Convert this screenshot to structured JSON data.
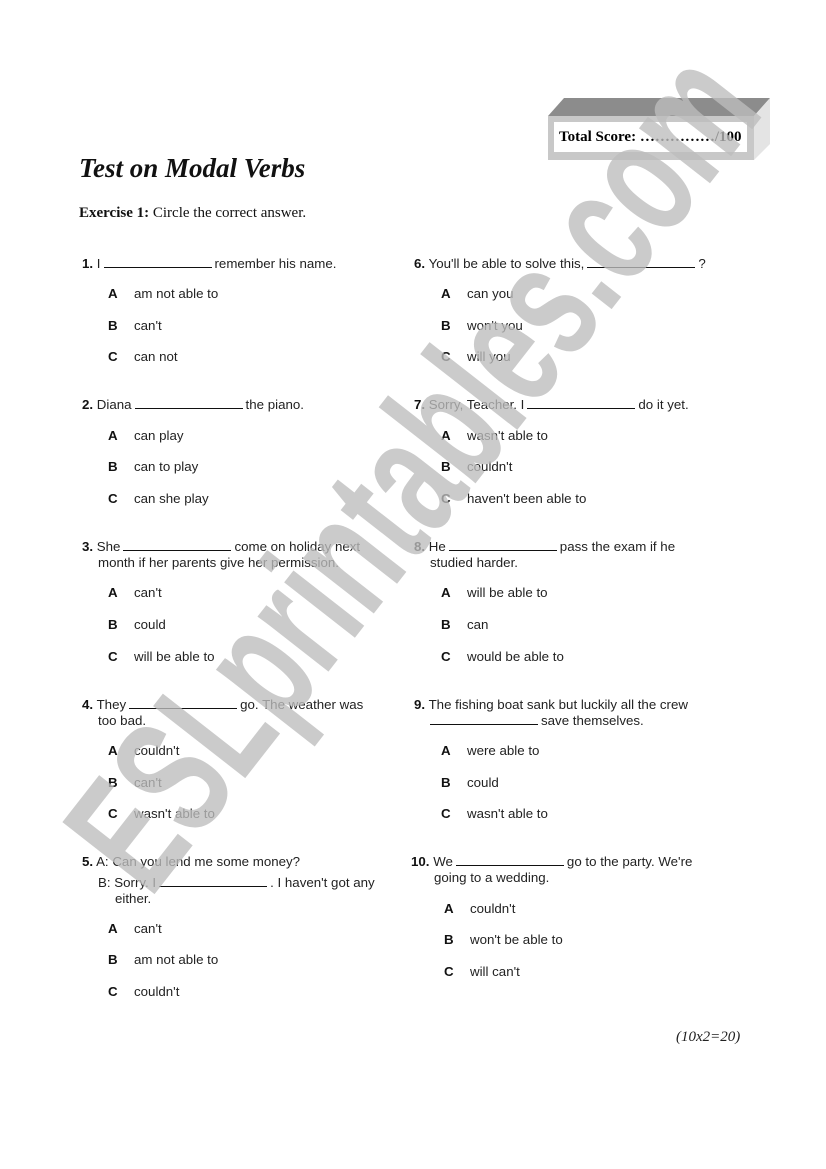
{
  "score": {
    "label": "Total Score: ……………/100"
  },
  "title": "Test on Modal Verbs",
  "exercise": {
    "label": "Exercise 1:",
    "instruction": "Circle the correct answer."
  },
  "questions": [
    {
      "num": "1.",
      "pre": "I",
      "post": "remember his name.",
      "cont": "",
      "options": [
        {
          "letter": "A",
          "text": "am not able to"
        },
        {
          "letter": "B",
          "text": "can't"
        },
        {
          "letter": "C",
          "text": "can not"
        }
      ]
    },
    {
      "num": "2.",
      "pre": "Diana",
      "post": "the piano.",
      "cont": "",
      "options": [
        {
          "letter": "A",
          "text": "can play"
        },
        {
          "letter": "B",
          "text": "can to play"
        },
        {
          "letter": "C",
          "text": "can she play"
        }
      ]
    },
    {
      "num": "3.",
      "pre": "She",
      "post": "come on holiday next",
      "cont": "month if her parents give her permission.",
      "options": [
        {
          "letter": "A",
          "text": "can't"
        },
        {
          "letter": "B",
          "text": "could"
        },
        {
          "letter": "C",
          "text": "will be able to"
        }
      ]
    },
    {
      "num": "4.",
      "pre": "They",
      "post": "go. The weather was",
      "cont": "too bad.",
      "options": [
        {
          "letter": "A",
          "text": "couldn't"
        },
        {
          "letter": "B",
          "text": "can't"
        },
        {
          "letter": "C",
          "text": "wasn't able to"
        }
      ]
    },
    {
      "num": "5.",
      "pre": "A: Can you lend me some money?",
      "line2_pre": "B: Sorry. I",
      "line2_post": ". I haven't got any",
      "cont": "either.",
      "options": [
        {
          "letter": "A",
          "text": "can't"
        },
        {
          "letter": "B",
          "text": "am not able to"
        },
        {
          "letter": "C",
          "text": "couldn't"
        }
      ]
    },
    {
      "num": "6.",
      "pre": "You'll be able to solve this,",
      "post": "?",
      "cont": "",
      "options": [
        {
          "letter": "A",
          "text": "can you"
        },
        {
          "letter": "B",
          "text": "won't you"
        },
        {
          "letter": "C",
          "text": "will you"
        }
      ]
    },
    {
      "num": "7.",
      "pre": "Sorry, Teacher. I",
      "post": "do it yet.",
      "cont": "",
      "options": [
        {
          "letter": "A",
          "text": "wasn't able to"
        },
        {
          "letter": "B",
          "text": "couldn't"
        },
        {
          "letter": "C",
          "text": "haven't been able to"
        }
      ]
    },
    {
      "num": "8.",
      "pre": "He",
      "post": "pass the exam if he",
      "cont": "studied harder.",
      "options": [
        {
          "letter": "A",
          "text": "will be able to"
        },
        {
          "letter": "B",
          "text": "can"
        },
        {
          "letter": "C",
          "text": "would be able to"
        }
      ]
    },
    {
      "num": "9.",
      "pre": "The fishing boat sank but luckily all the crew",
      "post": "save themselves.",
      "cont": "",
      "options": [
        {
          "letter": "A",
          "text": "were able to"
        },
        {
          "letter": "B",
          "text": "could"
        },
        {
          "letter": "C",
          "text": "wasn't able to"
        }
      ]
    },
    {
      "num": "10.",
      "pre": "We",
      "post": "go to the party. We're",
      "cont": "going to a wedding.",
      "options": [
        {
          "letter": "A",
          "text": "couldn't"
        },
        {
          "letter": "B",
          "text": "won't be able to"
        },
        {
          "letter": "C",
          "text": "will can't"
        }
      ]
    }
  ],
  "points_note": "(10x2=20)",
  "watermark": "ESLprintables.com"
}
